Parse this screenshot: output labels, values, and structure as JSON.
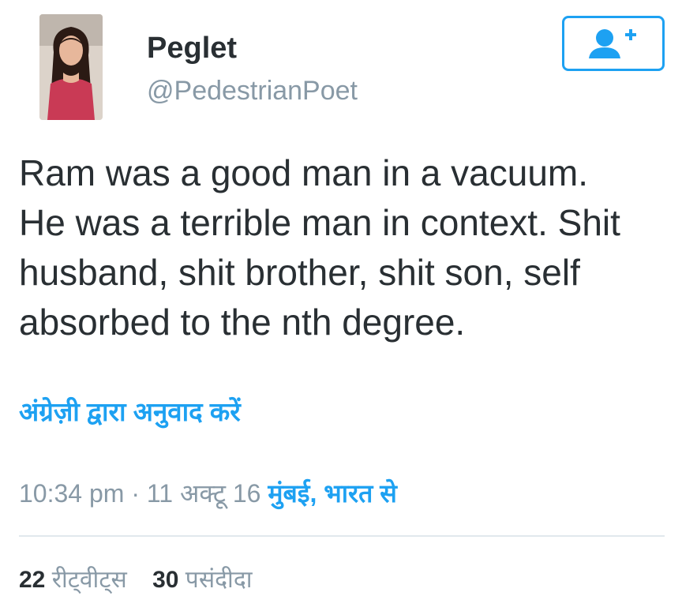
{
  "user": {
    "display_name": "Peglet",
    "handle": "@PedestrianPoet"
  },
  "follow_button": {
    "icon": "follow-user-plus-icon",
    "accent_color": "#1da1f2"
  },
  "tweet": {
    "lines": [
      "Ram was a good man in a vacuum.",
      "He was a terrible man in context. Shit",
      "husband, shit brother, shit son, self",
      "absorbed to the nth degree."
    ]
  },
  "translate_link": "अंग्रेज़ी द्वारा अनुवाद करें",
  "meta": {
    "time": "10:34 pm",
    "separator": "·",
    "date": "11 अक्टू 16",
    "location": "मुंबई, भारत से"
  },
  "stats": {
    "retweets_count": "22",
    "retweets_label": "रीट्वीट्स",
    "likes_count": "30",
    "likes_label": "पसंदीदा"
  },
  "colors": {
    "link": "#1da1f2",
    "text": "#292f33",
    "muted": "#8899a6",
    "divider": "#e1e8ed"
  }
}
